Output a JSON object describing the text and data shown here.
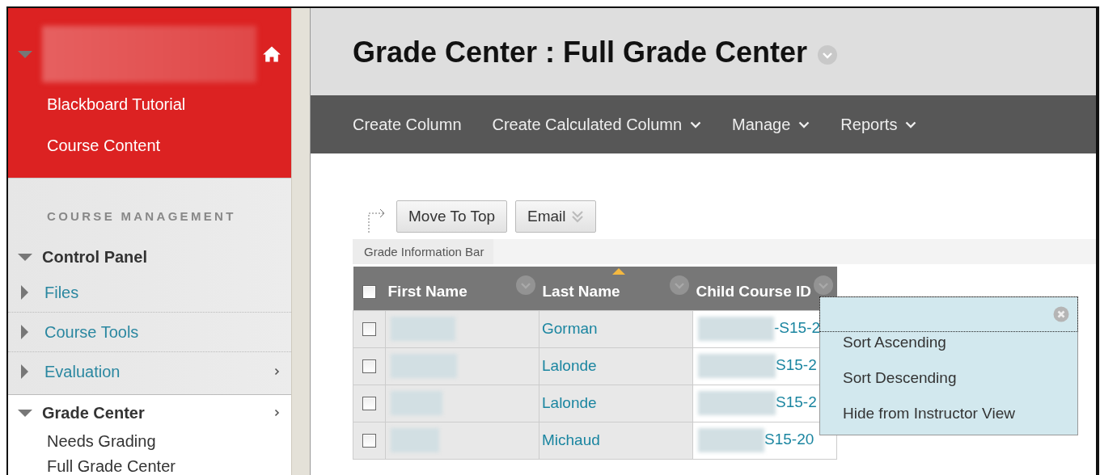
{
  "course_menu": {
    "expanded": true,
    "items": [
      "Blackboard Tutorial",
      "Course Content"
    ]
  },
  "course_management": {
    "heading": "COURSE MANAGEMENT",
    "panels": [
      {
        "label": "Control Panel",
        "expanded": true,
        "submenu": false,
        "children": [
          {
            "label": "Files",
            "kind": "folder",
            "expanded": false,
            "submenu": false
          },
          {
            "label": "Course Tools",
            "kind": "folder",
            "expanded": false,
            "submenu": false
          },
          {
            "label": "Evaluation",
            "kind": "folder",
            "expanded": false,
            "submenu": true
          }
        ]
      },
      {
        "label": "Grade Center",
        "expanded": true,
        "submenu": true,
        "children": [
          {
            "label": "Needs Grading",
            "kind": "page"
          },
          {
            "label": "Full Grade Center",
            "kind": "page"
          }
        ]
      }
    ]
  },
  "page_title": "Grade Center : Full Grade Center",
  "action_bar": [
    {
      "label": "Create Column",
      "menu": false
    },
    {
      "label": "Create Calculated Column",
      "menu": true
    },
    {
      "label": "Manage",
      "menu": true
    },
    {
      "label": "Reports",
      "menu": true
    }
  ],
  "buttons": [
    {
      "label": "Move To Top",
      "menu": false
    },
    {
      "label": "Email",
      "menu": true
    }
  ],
  "info_bar": "Grade Information Bar",
  "table": {
    "columns": [
      {
        "label": "First Name",
        "sorted": false
      },
      {
        "label": "Last Name",
        "sorted": true
      },
      {
        "label": "Child Course ID",
        "sorted": false
      }
    ],
    "rows": [
      {
        "checked": false,
        "last_name": "Gorman",
        "course_id": "-S15-2"
      },
      {
        "checked": false,
        "last_name": "Lalonde",
        "course_id": "S15-2"
      },
      {
        "checked": false,
        "last_name": "Lalonde",
        "course_id": "S15-2"
      },
      {
        "checked": false,
        "last_name": "Michaud",
        "course_id": "S15-20"
      }
    ],
    "all_checked": false
  },
  "column_menu": {
    "items": [
      "Sort Ascending",
      "Sort Descending",
      "Hide from Instructor View"
    ]
  }
}
